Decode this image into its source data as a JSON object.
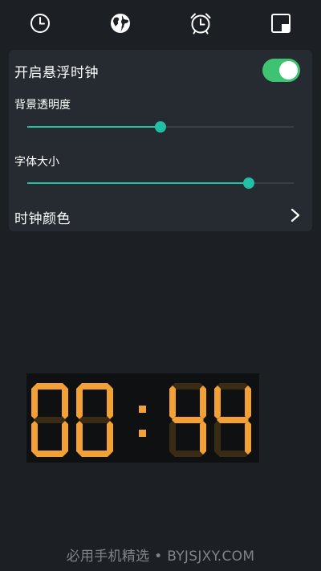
{
  "tabs": [
    {
      "icon": "clock-icon"
    },
    {
      "icon": "globe-icon"
    },
    {
      "icon": "alarm-clock-icon"
    },
    {
      "icon": "floating-window-icon"
    }
  ],
  "settings": {
    "float_clock_label": "开启悬浮时钟",
    "float_clock_enabled": true,
    "opacity_label": "背景透明度",
    "opacity_value": 0.5,
    "font_size_label": "字体大小",
    "font_size_value": 0.83,
    "clock_color_label": "时钟颜色"
  },
  "clock": {
    "hours": "00",
    "minutes": "44",
    "separator": ":",
    "digit_color": "#f3a035",
    "inactive_color": "#3a2b15"
  },
  "watermark": "必用手机精选 • BYJSJXY.COM",
  "colors": {
    "background": "#1c1f23",
    "card": "#262b32",
    "accent": "#21c1a6",
    "toggle_on": "#3ec373"
  }
}
